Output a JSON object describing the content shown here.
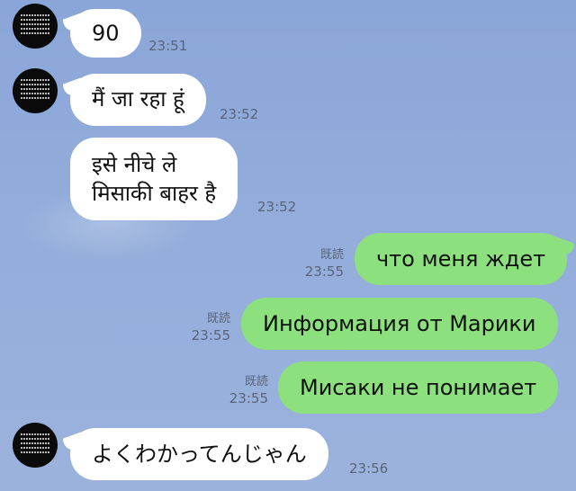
{
  "messages": [
    {
      "text": "90",
      "time": "23:51"
    },
    {
      "text": "मैं जा रहा हूं",
      "time": "23:52"
    },
    {
      "text": "इसे नीचे ले\nमिसाकी बाहर है",
      "time": "23:52"
    },
    {
      "text": "что меня ждет",
      "time": "23:55",
      "read": "既読"
    },
    {
      "text": "Информация от Марики",
      "time": "23:55",
      "read": "既読"
    },
    {
      "text": "Мисаки не понимает",
      "time": "23:55",
      "read": "既読"
    },
    {
      "text": "よくわかってんじゃん",
      "time": "23:56"
    }
  ],
  "colors": {
    "background": "#8fa8d6",
    "incoming_bubble": "#ffffff",
    "outgoing_bubble": "#8de07e",
    "meta_text": "#5a6478",
    "avatar": "#0a0a0a"
  }
}
